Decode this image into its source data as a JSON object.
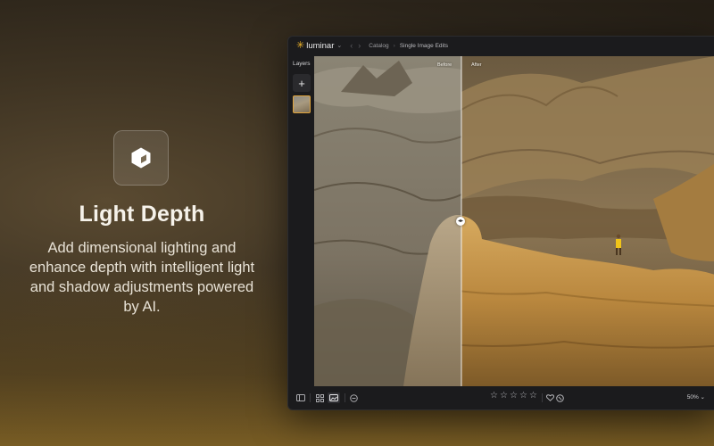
{
  "hero": {
    "icon": "depth-cube-icon",
    "title": "Light Depth",
    "description": "Add dimensional lighting and enhance depth with intelligent light and shadow adjustments powered by AI."
  },
  "app": {
    "logo_text": "luminar",
    "breadcrumb": [
      "Catalog",
      "Single Image Edits"
    ],
    "layers_label": "Layers",
    "before_label": "Before",
    "after_label": "After",
    "rating_stars": 5,
    "zoom": "50%",
    "colors": {
      "accent": "#f0b429",
      "window_bg": "#1b1b1d"
    },
    "toolbar_icons": [
      "sidebar-icon",
      "grid-view-icon",
      "single-view-icon",
      "compare-icon",
      "heart-icon",
      "reject-icon"
    ]
  }
}
